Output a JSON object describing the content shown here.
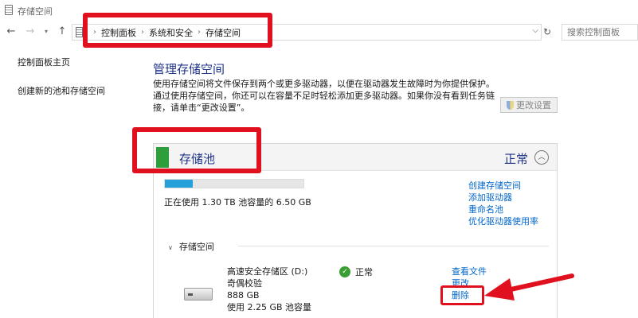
{
  "window": {
    "title": "存储空间"
  },
  "address": {
    "crumbs": [
      "控制面板",
      "系统和安全",
      "存储空间"
    ],
    "search_placeholder": "搜索控制面板"
  },
  "leftnav": {
    "items": [
      "控制面板主页",
      "创建新的池和存储空间"
    ]
  },
  "main": {
    "title": "管理存储空间",
    "description": "使用存储空间将文件保存到两个或更多驱动器，以便在驱动器发生故障时为你提供保护。通过使用存储空间，你还可以在容量不足时轻松添加更多驱动器。如果你没有看到任务链接，请单击“更改设置”。",
    "change_settings_label": "更改设置"
  },
  "pool": {
    "title": "存储池",
    "status": "正常",
    "usage_fraction": 0.2,
    "usage_text": "正在使用 1.30 TB 池容量的 6.50 GB",
    "links": [
      "创建存储空间",
      "添加驱动器",
      "重命名池",
      "优化驱动器使用率"
    ]
  },
  "spaces": {
    "section_label": "存储空间",
    "items": [
      {
        "name": "高速安全存储区 (D:)",
        "resiliency": "奇偶校验",
        "size": "888 GB",
        "usage": "使用 2.25 GB 池容量",
        "status": "正常",
        "links": [
          "查看文件",
          "更改",
          "删除"
        ]
      }
    ]
  },
  "colors": {
    "accent_blue": "#1e3287",
    "link_blue": "#0066cc",
    "annotation_red": "#e0101e",
    "pool_green": "#2e9e3c"
  },
  "icons": [
    "storage-spaces-icon",
    "back-arrow-icon",
    "forward-arrow-icon",
    "up-arrow-icon",
    "chevron-down-icon",
    "refresh-icon",
    "shield-icon",
    "collapse-chevron-icon",
    "check-icon",
    "drive-icon"
  ]
}
